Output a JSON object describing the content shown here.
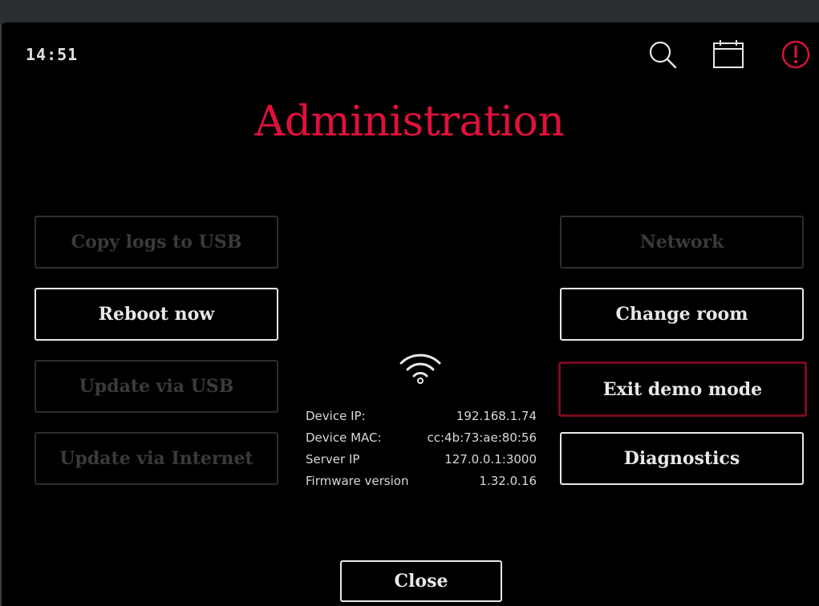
{
  "header": {
    "time": "14:51",
    "icons": [
      "search-icon",
      "calendar-icon",
      "alert-icon"
    ]
  },
  "title": "Administration",
  "left_buttons": [
    {
      "label": "Copy logs to USB",
      "enabled": false
    },
    {
      "label": "Reboot now",
      "enabled": true
    },
    {
      "label": "Update via USB",
      "enabled": false
    },
    {
      "label": "Update via Internet",
      "enabled": false
    }
  ],
  "right_buttons": [
    {
      "label": "Network",
      "enabled": false
    },
    {
      "label": "Change room",
      "enabled": true
    },
    {
      "label": "Exit demo mode",
      "enabled": true,
      "focused": true
    },
    {
      "label": "Diagnostics",
      "enabled": true
    }
  ],
  "device_info": {
    "rows": [
      {
        "label": "Device IP:",
        "value": "192.168.1.74"
      },
      {
        "label": "Device MAC:",
        "value": "cc:4b:73:ae:80:56"
      },
      {
        "label": "Server IP",
        "value": "127.0.0.1:3000"
      },
      {
        "label": "Firmware version",
        "value": "1.32.0.16"
      }
    ]
  },
  "close_label": "Close",
  "colors": {
    "accent": "#e0103c",
    "focus_border": "#7a0a20",
    "background": "#000000"
  }
}
